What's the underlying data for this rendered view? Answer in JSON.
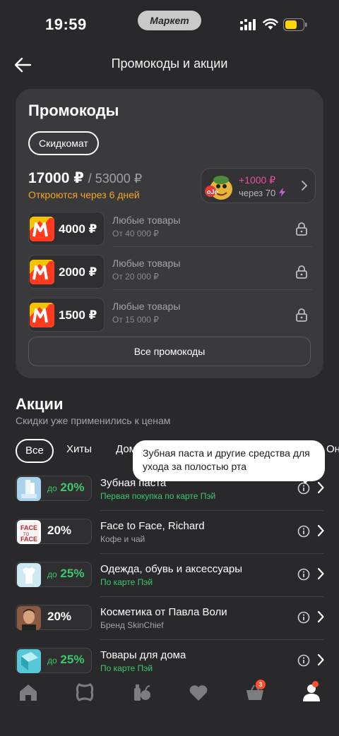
{
  "status_bar": {
    "time": "19:59",
    "market_label": "Маркет"
  },
  "header": {
    "title": "Промокоды и акции"
  },
  "promocodes": {
    "title": "Промокоды",
    "skidkomat_label": "Скидкомат",
    "amount": "17000 ₽",
    "amount_total": "/ 53000 ₽",
    "unlock_note": "Откроются через 6 дней",
    "bonus": {
      "plus": "+1000 ₽",
      "after": "через 70"
    },
    "coupons": [
      {
        "value": "4000 ₽",
        "desc": "Любые товары",
        "min": "От 40 000 ₽"
      },
      {
        "value": "2000 ₽",
        "desc": "Любые товары",
        "min": "От 20 000 ₽"
      },
      {
        "value": "1500 ₽",
        "desc": "Любые товары",
        "min": "От 15 000 ₽"
      }
    ],
    "all_button": "Все промокоды"
  },
  "akcii": {
    "title": "Акции",
    "subtitle": "Скидки уже применились к ценам",
    "chips": [
      "Все",
      "Хиты",
      "Дом",
      "Они"
    ],
    "tooltip": "Зубная паста и другие средства для ухода за полостью рта",
    "deals": [
      {
        "do": "до",
        "pct": "20%",
        "name": "Зубная паста",
        "sub": "Первая покупка по карте Пэй",
        "green": true
      },
      {
        "do": "",
        "pct": "20%",
        "name": "Face to Face, Richard",
        "sub": "Кофе и чай",
        "green": false
      },
      {
        "do": "до",
        "pct": "25%",
        "name": "Одежда, обувь и аксессуары",
        "sub": "По карте Пэй",
        "green": true
      },
      {
        "do": "",
        "pct": "20%",
        "name": "Косметика от Павла Воли",
        "sub": "Бренд SkinChief",
        "green": false
      },
      {
        "do": "до",
        "pct": "25%",
        "name": "Товары для дома",
        "sub": "По карте Пэй",
        "green": true
      }
    ]
  },
  "bottom_nav": {
    "cart_badge": "3"
  },
  "colors": {
    "background": "#29292b",
    "card": "#3a3a3c",
    "accent_orange": "#f5a623",
    "green": "#3cc86d",
    "pink": "#e84ea6",
    "badge": "#ff4d2e"
  }
}
